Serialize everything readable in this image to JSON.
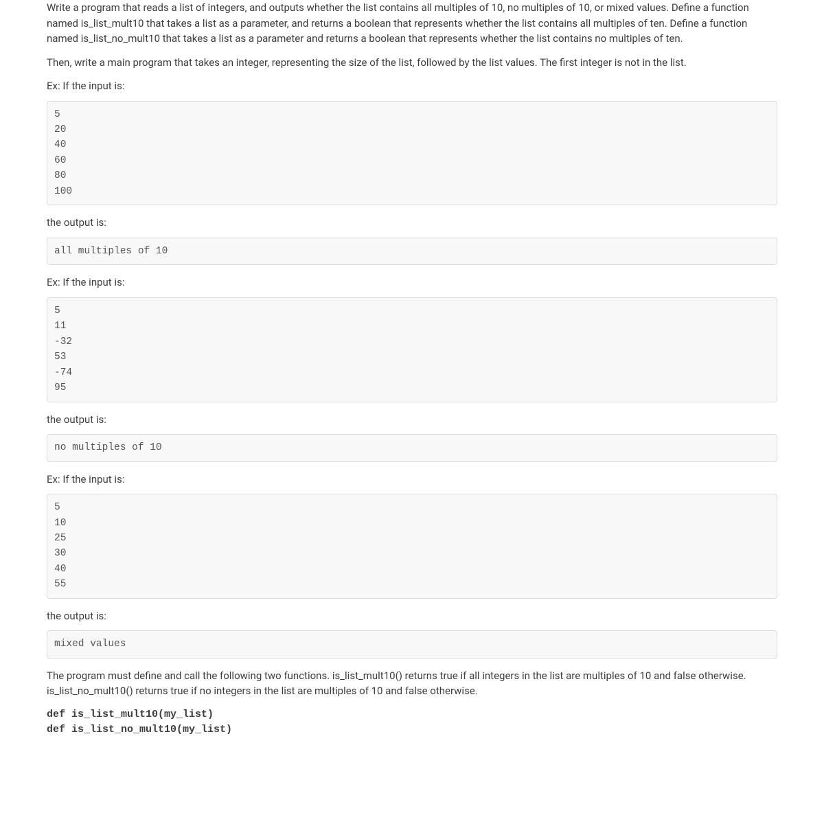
{
  "intro": {
    "p1": "Write a program that reads a list of integers, and outputs whether the list contains all multiples of 10, no multiples of 10, or mixed values. Define a function named is_list_mult10 that takes a list as a parameter, and returns a boolean that represents whether the list contains all multiples of ten. Define a function named is_list_no_mult10 that takes a list as a parameter and returns a boolean that represents whether the list contains no multiples of ten.",
    "p2": "Then, write a main program that takes an integer, representing the size of the list, followed by the list values. The first integer is not in the list."
  },
  "labels": {
    "ex_input": "Ex: If the input is:",
    "output": "the output is:"
  },
  "example1": {
    "input": "5\n20\n40\n60\n80\n100",
    "output": "all multiples of 10"
  },
  "example2": {
    "input": "5\n11\n-32\n53\n-74\n95",
    "output": "no multiples of 10"
  },
  "example3": {
    "input": "5\n10\n25\n30\n40\n55",
    "output": "mixed values"
  },
  "closing": {
    "text": "The program must define and call the following two functions. is_list_mult10() returns true if all integers in the list are multiples of 10 and false otherwise. is_list_no_mult10() returns true if no integers in the list are multiples of 10 and false otherwise.",
    "def1": "def is_list_mult10(my_list)",
    "def2": "def is_list_no_mult10(my_list)"
  }
}
